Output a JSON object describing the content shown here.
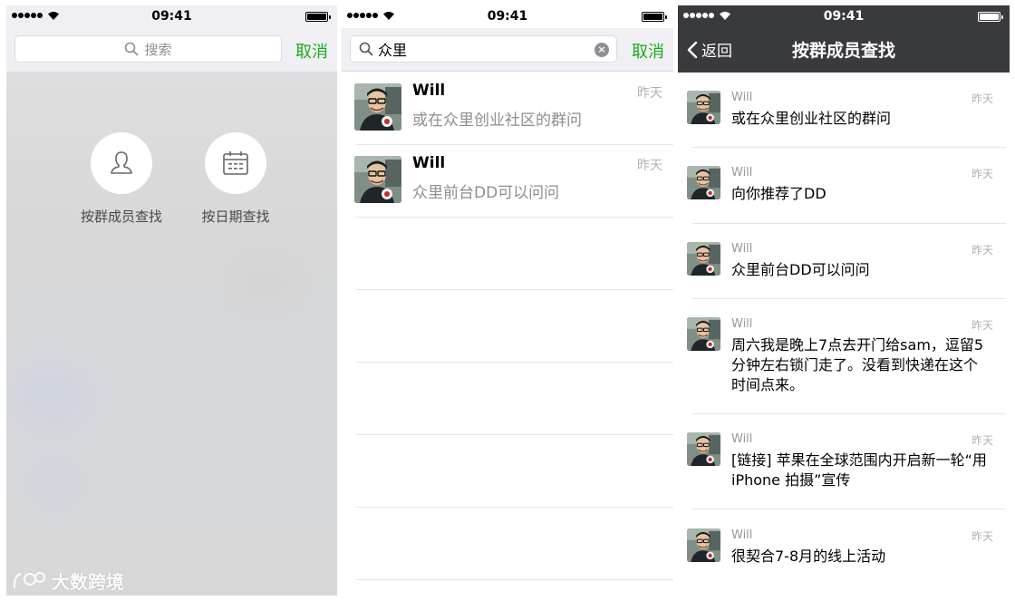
{
  "status": {
    "time": "09:41"
  },
  "panel1": {
    "search_placeholder": "搜索",
    "cancel_label": "取消",
    "options": [
      {
        "label": "按群成员查找",
        "icon": "members-icon"
      },
      {
        "label": "按日期查找",
        "icon": "calendar-icon"
      }
    ],
    "watermark": "大数跨境"
  },
  "panel2": {
    "search_value": "众里",
    "cancel_label": "取消",
    "results": [
      {
        "name": "Will",
        "snippet": "或在众里创业社区的群问",
        "time": "昨天"
      },
      {
        "name": "Will",
        "snippet": "众里前台DD可以问问",
        "time": "昨天"
      }
    ]
  },
  "panel3": {
    "back_label": "返回",
    "title": "按群成员查找",
    "messages": [
      {
        "name": "Will",
        "time": "昨天",
        "text": "或在众里创业社区的群问"
      },
      {
        "name": "Will",
        "time": "昨天",
        "text": "向你推荐了DD"
      },
      {
        "name": "Will",
        "time": "昨天",
        "text": "众里前台DD可以问问"
      },
      {
        "name": "Will",
        "time": "昨天",
        "text": "周六我是晚上7点去开门给sam，逗留5分钟左右锁门走了。没看到快递在这个时间点来。"
      },
      {
        "name": "Will",
        "time": "昨天",
        "text": "[链接] 苹果在全球范围内开启新一轮“用 iPhone 拍摄”宣传"
      },
      {
        "name": "Will",
        "time": "昨天",
        "text": "很契合7-8月的线上活动"
      }
    ]
  },
  "colors": {
    "accent_green": "#1aad19",
    "navbar": "#393a3e",
    "secondary_text": "#8e8e93"
  }
}
